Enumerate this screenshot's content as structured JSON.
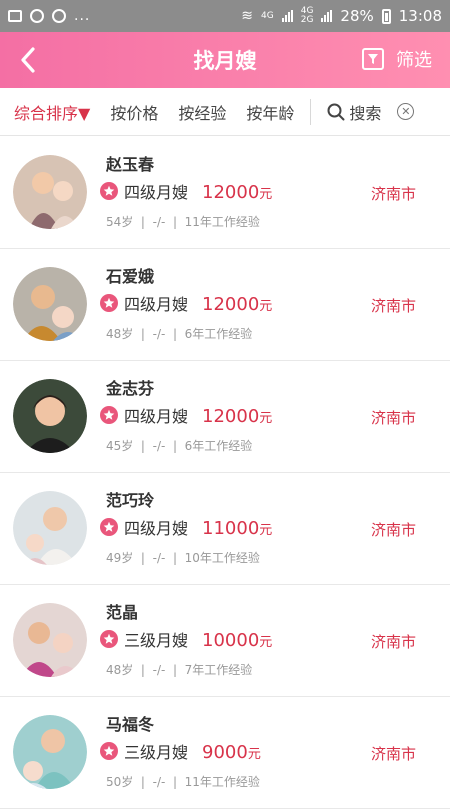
{
  "status_bar": {
    "ellipsis": "...",
    "net_top": "4G",
    "net_mid_top": "4G",
    "net_mid_bottom": "2G",
    "battery": "28%",
    "time": "13:08"
  },
  "header": {
    "title": "找月嫂",
    "filter_label": "筛选",
    "background": "#f46fa4"
  },
  "sortbar": {
    "active": "综合排序▼",
    "price": "按价格",
    "experience": "按经验",
    "age": "按年龄",
    "search": "搜索"
  },
  "colors": {
    "accent": "#d8334a",
    "star": "#e9567b"
  },
  "caregivers": [
    {
      "name": "赵玉春",
      "level": "四级月嫂",
      "price": "12000",
      "unit": "元",
      "age": "54岁",
      "sep1": "|",
      "dash": "-/-",
      "sep2": "|",
      "experience": "11年工作经验",
      "city": "济南市"
    },
    {
      "name": "石爱娥",
      "level": "四级月嫂",
      "price": "12000",
      "unit": "元",
      "age": "48岁",
      "sep1": "|",
      "dash": "-/-",
      "sep2": "|",
      "experience": "6年工作经验",
      "city": "济南市"
    },
    {
      "name": "金志芬",
      "level": "四级月嫂",
      "price": "12000",
      "unit": "元",
      "age": "45岁",
      "sep1": "|",
      "dash": "-/-",
      "sep2": "|",
      "experience": "6年工作经验",
      "city": "济南市"
    },
    {
      "name": "范巧玲",
      "level": "四级月嫂",
      "price": "11000",
      "unit": "元",
      "age": "49岁",
      "sep1": "|",
      "dash": "-/-",
      "sep2": "|",
      "experience": "10年工作经验",
      "city": "济南市"
    },
    {
      "name": "范晶",
      "level": "三级月嫂",
      "price": "10000",
      "unit": "元",
      "age": "48岁",
      "sep1": "|",
      "dash": "-/-",
      "sep2": "|",
      "experience": "7年工作经验",
      "city": "济南市"
    },
    {
      "name": "马福冬",
      "level": "三级月嫂",
      "price": "9000",
      "unit": "元",
      "age": "50岁",
      "sep1": "|",
      "dash": "-/-",
      "sep2": "|",
      "experience": "11年工作经验",
      "city": "济南市"
    }
  ]
}
